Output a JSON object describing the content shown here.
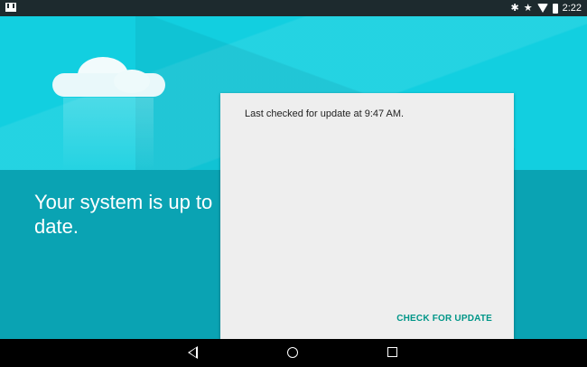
{
  "status_bar": {
    "time": "2:22",
    "left_icons": [
      "gmail-icon"
    ],
    "right_icons": [
      "bluetooth-icon",
      "star-icon",
      "wifi-icon",
      "battery-icon"
    ]
  },
  "main": {
    "headline": "Your system is up to date."
  },
  "card": {
    "last_checked": "Last checked for update at 9:47 AM.",
    "check_button": "CHECK FOR UPDATE"
  },
  "nav_bar": {
    "icons": [
      "back-icon",
      "home-icon",
      "recents-icon"
    ]
  },
  "colors": {
    "sky": "#12cfe0",
    "sea": "#0aa3b3",
    "accent": "#009688",
    "card_bg": "#eeeeee"
  }
}
